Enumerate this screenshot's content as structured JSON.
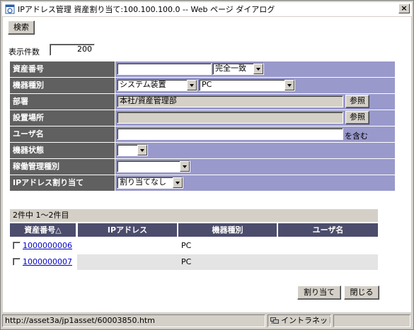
{
  "window": {
    "title": "IPアドレス管理 資産割り当て:100.100.100.0 -- Web ページ ダイアログ",
    "close_label": "×"
  },
  "toolbar": {
    "search_label": "検索"
  },
  "display_count": {
    "label": "表示件数",
    "value": "200"
  },
  "form": {
    "asset_number": {
      "label": "資産番号",
      "value": "",
      "match": "完全一致"
    },
    "device_type": {
      "label": "機器種別",
      "category": "システム装置",
      "type": "PC"
    },
    "department": {
      "label": "部署",
      "value": "本社/資産管理部",
      "ref_label": "参照"
    },
    "location": {
      "label": "設置場所",
      "value": "",
      "ref_label": "参照"
    },
    "user_name": {
      "label": "ユーザ名",
      "value": "",
      "suffix": "を含む"
    },
    "device_status": {
      "label": "機器状態",
      "value": ""
    },
    "operation_type": {
      "label": "稼働管理種別",
      "value": ""
    },
    "ip_assign": {
      "label": "IPアドレス割り当て",
      "value": "割り当てなし"
    }
  },
  "results": {
    "summary": "2件中 1～2件目",
    "columns": [
      "資産番号△",
      "IPアドレス",
      "機器種別",
      "ユーザ名"
    ],
    "rows": [
      {
        "asset_number": "1000000006",
        "ip": "",
        "type": "PC",
        "user": ""
      },
      {
        "asset_number": "1000000007",
        "ip": "",
        "type": "PC",
        "user": ""
      }
    ]
  },
  "actions": {
    "assign_label": "割り当て",
    "close_label": "閉じる"
  },
  "status": {
    "url": "http://asset3a/jp1asset/60003850.htm",
    "zone": "イントラネット"
  },
  "colors": {
    "header_gray": "#606060",
    "cell_purple": "#9999cc",
    "grid_header": "#4c4c6c",
    "link": "#0000cc"
  }
}
